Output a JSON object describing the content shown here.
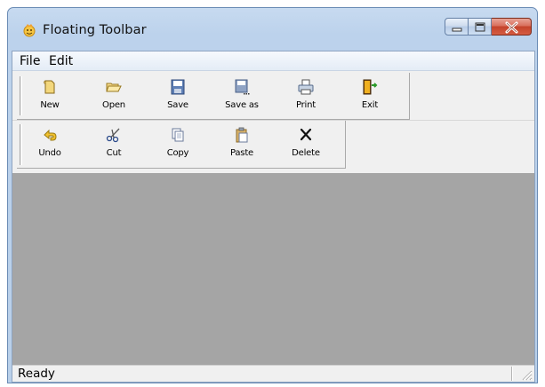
{
  "window": {
    "title": "Floating Toolbar",
    "icon": "app-smiley-icon",
    "caption_buttons": [
      "minimize-icon",
      "maximize-icon",
      "close-icon"
    ]
  },
  "menu": {
    "items": [
      {
        "label": "File"
      },
      {
        "label": "Edit"
      }
    ]
  },
  "toolbar_top": {
    "buttons": [
      {
        "label": "New",
        "icon": "new-document-icon"
      },
      {
        "label": "Open",
        "icon": "open-folder-icon"
      },
      {
        "label": "Save",
        "icon": "floppy-disk-icon"
      },
      {
        "label": "Save as",
        "icon": "save-as-icon"
      },
      {
        "label": "Print",
        "icon": "printer-icon"
      },
      {
        "label": "Exit",
        "icon": "exit-door-icon"
      }
    ]
  },
  "toolbar_bottom": {
    "buttons": [
      {
        "label": "Undo",
        "icon": "undo-arrow-icon"
      },
      {
        "label": "Cut",
        "icon": "scissors-icon"
      },
      {
        "label": "Copy",
        "icon": "copy-icon"
      },
      {
        "label": "Paste",
        "icon": "paste-clipboard-icon"
      },
      {
        "label": "Delete",
        "icon": "delete-x-icon"
      }
    ]
  },
  "status": {
    "text": "Ready"
  },
  "colors": {
    "content_background": "#a5a5a5",
    "client_background": "#f0f0f0",
    "close_button": "#c4432b"
  }
}
